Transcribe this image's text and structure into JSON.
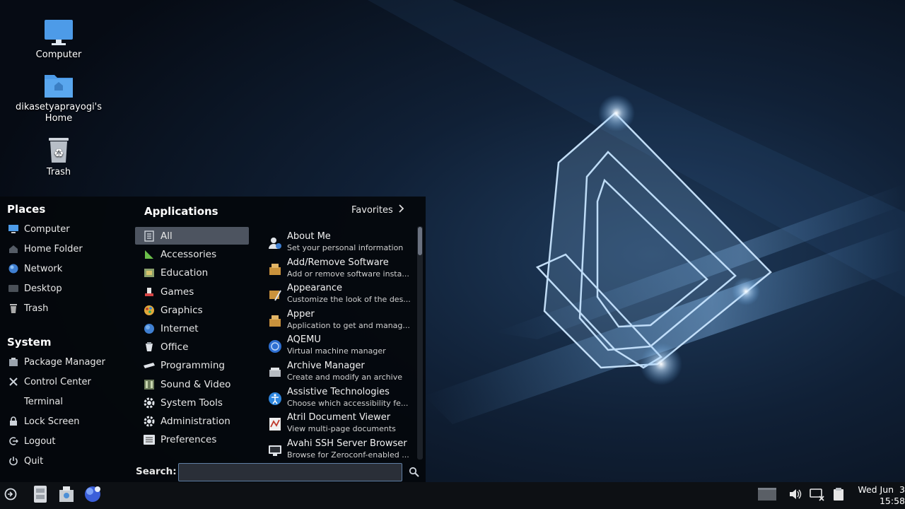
{
  "desktop": {
    "icons": [
      {
        "label": "Computer",
        "icon": "monitor-icon"
      },
      {
        "label": "dikasetyaprayogi's\nHome",
        "icon": "home-folder-icon"
      },
      {
        "label": "Trash",
        "icon": "trash-icon"
      }
    ]
  },
  "menu": {
    "places_heading": "Places",
    "places": [
      {
        "label": "Computer",
        "icon": "monitor-icon"
      },
      {
        "label": "Home Folder",
        "icon": "home-icon"
      },
      {
        "label": "Network",
        "icon": "network-icon"
      },
      {
        "label": "Desktop",
        "icon": "desktop-icon"
      },
      {
        "label": "Trash",
        "icon": "trash-icon"
      }
    ],
    "system_heading": "System",
    "system": [
      {
        "label": "Package Manager",
        "icon": "package-icon"
      },
      {
        "label": "Control Center",
        "icon": "tools-icon"
      },
      {
        "label": "Terminal",
        "icon": "terminal-icon"
      },
      {
        "label": "Lock Screen",
        "icon": "lock-icon"
      },
      {
        "label": "Logout",
        "icon": "logout-icon"
      },
      {
        "label": "Quit",
        "icon": "power-icon"
      }
    ],
    "applications_heading": "Applications",
    "favorites_label": "Favorites",
    "categories": [
      {
        "label": "All",
        "icon": "list-icon",
        "active": true
      },
      {
        "label": "Accessories",
        "icon": "accessories-icon"
      },
      {
        "label": "Education",
        "icon": "education-icon"
      },
      {
        "label": "Games",
        "icon": "games-icon"
      },
      {
        "label": "Graphics",
        "icon": "graphics-icon"
      },
      {
        "label": "Internet",
        "icon": "globe-icon"
      },
      {
        "label": "Office",
        "icon": "office-icon"
      },
      {
        "label": "Programming",
        "icon": "programming-icon"
      },
      {
        "label": "Sound & Video",
        "icon": "multimedia-icon"
      },
      {
        "label": "System Tools",
        "icon": "gear-icon"
      },
      {
        "label": "Administration",
        "icon": "gear-icon"
      },
      {
        "label": "Preferences",
        "icon": "preferences-icon"
      }
    ],
    "apps": [
      {
        "name": "About Me",
        "desc": "Set your personal information",
        "icon": "user-info-icon"
      },
      {
        "name": "Add/Remove Software",
        "desc": "Add or remove software insta...",
        "icon": "package-icon"
      },
      {
        "name": "Appearance",
        "desc": "Customize the look of the des...",
        "icon": "appearance-icon"
      },
      {
        "name": "Apper",
        "desc": "Application to get and manag...",
        "icon": "package-icon"
      },
      {
        "name": "AQEMU",
        "desc": "Virtual machine manager",
        "icon": "aqemu-icon"
      },
      {
        "name": "Archive Manager",
        "desc": "Create and modify an archive",
        "icon": "archive-icon"
      },
      {
        "name": "Assistive Technologies",
        "desc": "Choose which accessibility fe...",
        "icon": "accessibility-icon"
      },
      {
        "name": "Atril Document Viewer",
        "desc": "View multi-page documents",
        "icon": "document-viewer-icon"
      },
      {
        "name": "Avahi SSH Server Browser",
        "desc": "Browse for Zeroconf-enabled ...",
        "icon": "ssh-browser-icon"
      }
    ],
    "search_label": "Search:",
    "search_value": "",
    "search_placeholder": ""
  },
  "taskbar": {
    "clock_date": "Wed Jun  3",
    "clock_time": "15:58"
  },
  "colors": {
    "accent": "#4d8fd6",
    "menu_bg": "#04070c",
    "active_category": "#4d5460"
  }
}
